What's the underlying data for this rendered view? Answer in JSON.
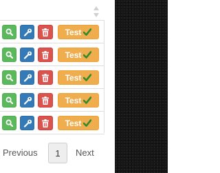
{
  "table": {
    "rows": [
      {
        "test_label": "Test"
      },
      {
        "test_label": "Test"
      },
      {
        "test_label": "Test"
      },
      {
        "test_label": "Test"
      },
      {
        "test_label": "Test"
      }
    ]
  },
  "icons": {
    "sort": "sort-icon",
    "view": "search-icon",
    "edit": "wrench-icon",
    "delete": "trash-icon",
    "test": "check-icon"
  },
  "pagination": {
    "previous_label": "Previous",
    "current_page": "1",
    "next_label": "Next"
  },
  "colors": {
    "view": "#5cb85c",
    "edit": "#337ab7",
    "delete": "#d9534f",
    "test": "#f0ad4e",
    "check": "#2e8b2e",
    "background_dark": "#161616"
  }
}
